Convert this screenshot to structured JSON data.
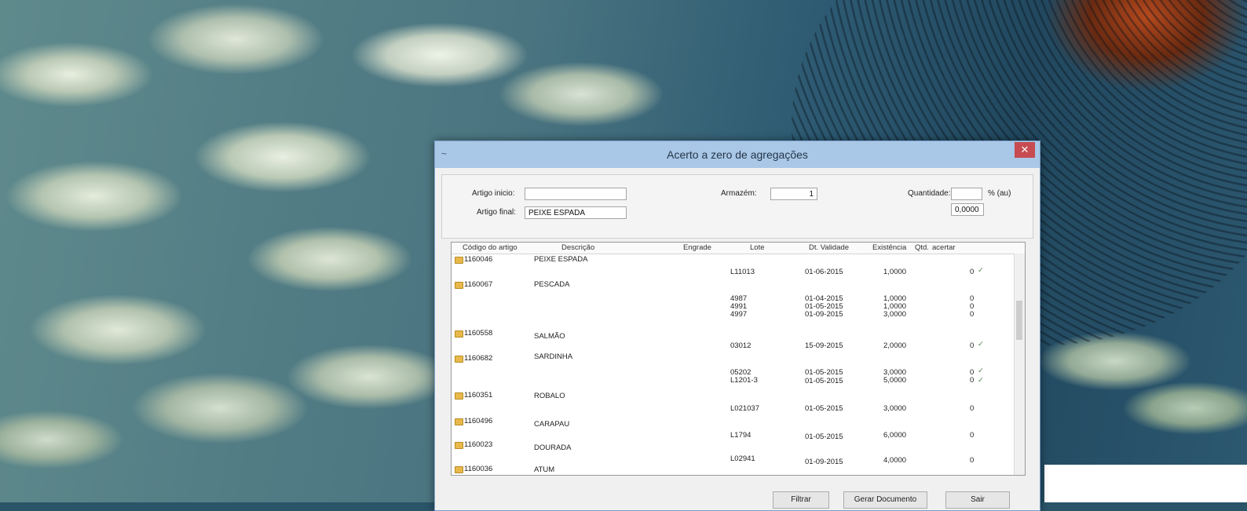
{
  "dialog": {
    "title": "Acerto a zero de agregações",
    "close_glyph": "✕",
    "system_icon": "~"
  },
  "form": {
    "artigo_inicio_label": "Artigo inicio:",
    "artigo_inicio_value": "",
    "artigo_fim_label": "Artigo final:",
    "artigo_fim_value": "PEIXE ESPADA",
    "armazem_label": "Armazém:",
    "armazem_value": "1",
    "quantidade_label": "Quantidade:",
    "quantidade_value": "",
    "percent_label": "% (au)",
    "percent_value": "0,0000"
  },
  "grid": {
    "columns": [
      "Código do artigo",
      "Descrição",
      "Engrade",
      "Lote",
      "Dt. Validade",
      "Existência",
      "Qtd.",
      "acertar"
    ],
    "items": [
      {
        "code": "1160046",
        "desc": "PEIXE ESPADA"
      },
      {
        "code": "1160067",
        "desc": "PESCADA"
      },
      {
        "code": "1160558",
        "desc": "SALMÃO"
      },
      {
        "code": "1160682",
        "desc": "SARDINHA"
      },
      {
        "code": "1160351",
        "desc": "ROBALO"
      },
      {
        "code": "1160496",
        "desc": "CARAPAU"
      },
      {
        "code": "1160023",
        "desc": "DOURADA"
      },
      {
        "code": "1160036",
        "desc": "ATUM"
      }
    ],
    "lots": [
      {
        "lote": "L11013",
        "validade": "01-06-2015",
        "existencia": "1,0000",
        "flag": "0",
        "check": "✓"
      },
      {
        "lote": "4987",
        "validade": "01-04-2015",
        "existencia": "1,0000",
        "flag": "0",
        "check": ""
      },
      {
        "lote": "4991",
        "validade": "01-05-2015",
        "existencia": "1,0000",
        "flag": "0",
        "check": ""
      },
      {
        "lote": "4997",
        "validade": "01-09-2015",
        "existencia": "3,0000",
        "flag": "0",
        "check": ""
      },
      {
        "lote": "03012",
        "validade": "15-09-2015",
        "existencia": "2,0000",
        "flag": "0",
        "check": "✓"
      },
      {
        "lote": "05202",
        "validade": "01-05-2015",
        "existencia": "3,0000",
        "flag": "0",
        "check": "✓"
      },
      {
        "lote": "L1201-3",
        "validade": "01-05-2015",
        "existencia": "5,0000",
        "flag": "0",
        "check": "✓"
      },
      {
        "lote": "L021037",
        "validade": "01-05-2015",
        "existencia": "3,0000",
        "flag": "0",
        "check": ""
      },
      {
        "lote": "L1794",
        "validade": "01-05-2015",
        "existencia": "6,0000",
        "flag": "0",
        "check": ""
      },
      {
        "lote": "L02941",
        "validade": "01-09-2015",
        "existencia": "4,0000",
        "flag": "0",
        "check": ""
      }
    ]
  },
  "buttons": {
    "filtrar": "Filtrar",
    "gerar": "Gerar Documento",
    "sair": "Sair"
  }
}
